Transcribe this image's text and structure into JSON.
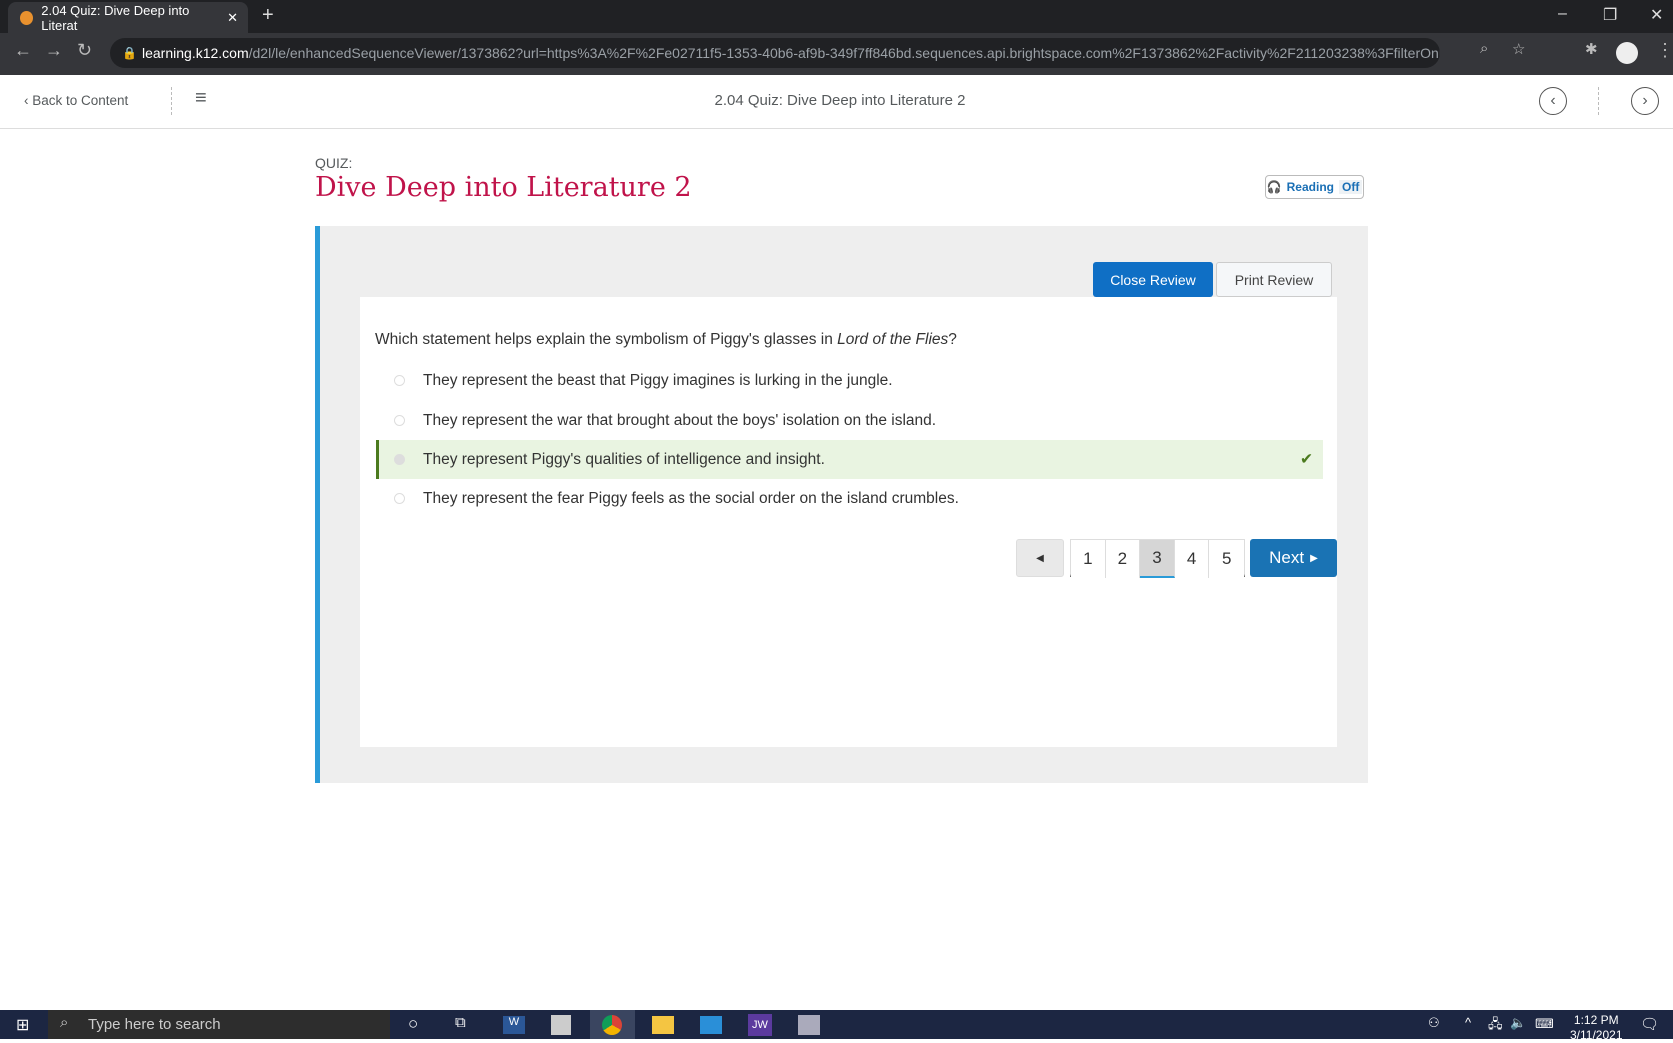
{
  "browser": {
    "tab_title": "2.04 Quiz: Dive Deep into Literat",
    "url_host": "learning.k12.com",
    "url_path": "/d2l/le/enhancedSequenceViewer/1373862?url=https%3A%2F%2Fe02711f5-1353-40b6-af9b-349f7ff846bd.sequences.api.brightspace.com%2F1373862%2Factivity%2F211203238%3FfilterOnD..."
  },
  "header": {
    "back_label": "Back to Content",
    "title": "2.04 Quiz: Dive Deep into Literature 2"
  },
  "quiz": {
    "label": "QUIZ:",
    "title": "Dive Deep into Literature 2",
    "reading_label": "Reading",
    "reading_state": "Off",
    "close_review": "Close Review",
    "print_review": "Print Review",
    "question_pre": "Which statement helps explain the symbolism of Piggy's glasses in ",
    "question_italic": "Lord of the Flies",
    "question_post": "?",
    "options": [
      {
        "text": "They represent the beast that Piggy imagines is lurking in the jungle.",
        "selected": false
      },
      {
        "text": "They represent the war that brought about the boys' isolation on the island.",
        "selected": false
      },
      {
        "text": "They represent Piggy's qualities of intelligence and insight.",
        "selected": true,
        "correct": true
      },
      {
        "text": "They represent the fear Piggy feels as the social order on the island crumbles.",
        "selected": false
      }
    ],
    "pages": [
      "1",
      "2",
      "3",
      "4",
      "5"
    ],
    "current_page": "3",
    "next_label": "Next"
  },
  "taskbar": {
    "search_placeholder": "Type here to search",
    "time": "1:12 PM",
    "date": "3/11/2021",
    "jw": "JW"
  },
  "colors": {
    "accent_title": "#c0134a",
    "primary": "#0f6fc5",
    "next": "#1a73b4",
    "correct_bg": "#e9f4e1",
    "correct_bar": "#4b7a1e"
  }
}
